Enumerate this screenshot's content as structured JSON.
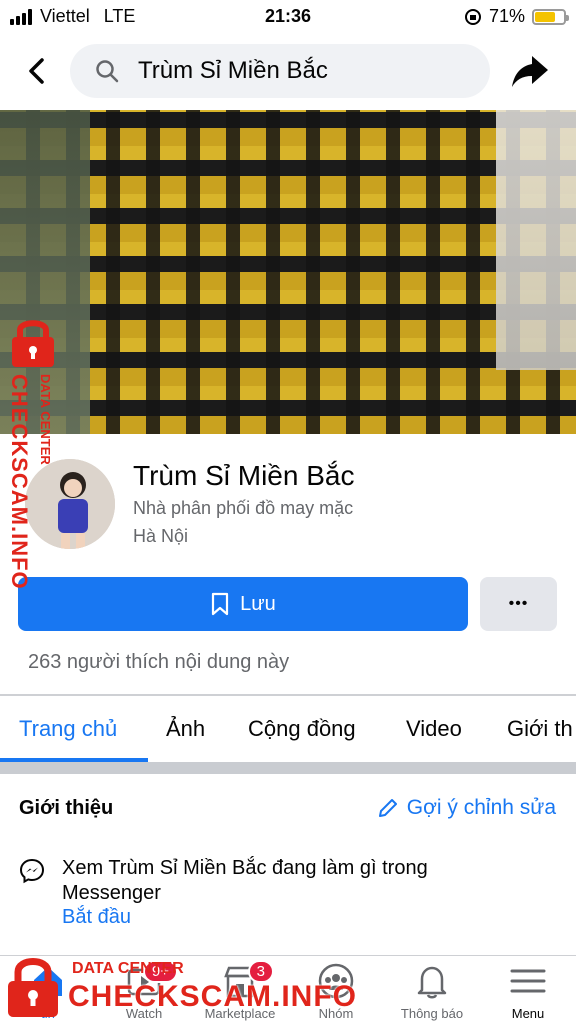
{
  "status_bar": {
    "carrier": "Viettel",
    "network": "LTE",
    "time": "21:36",
    "battery": "71%",
    "battery_level": 0.71
  },
  "search": {
    "query": "Trùm Sỉ Miền Bắc"
  },
  "profile": {
    "name": "Trùm Sỉ Miền Bắc",
    "category": "Nhà phân phối đồ may mặc",
    "location": "Hà Nội",
    "save_label": "Lưu",
    "more_label": "•••",
    "likes_text": "263 người thích nội dung này"
  },
  "tabs": [
    {
      "label": "Trang chủ",
      "active": true
    },
    {
      "label": "Ảnh",
      "active": false
    },
    {
      "label": "Cộng đồng",
      "active": false
    },
    {
      "label": "Video",
      "active": false
    },
    {
      "label": "Giới th",
      "active": false
    }
  ],
  "intro": {
    "title": "Giới thiệu",
    "suggest_edit": "Gợi ý chỉnh sửa",
    "messenger_text": "Xem Trùm Sỉ Miền Bắc đang làm gì trong Messenger",
    "messenger_link": "Bắt đầu"
  },
  "bottom_nav": [
    {
      "label": "tin",
      "icon": "home-icon",
      "active": true
    },
    {
      "label": "Watch",
      "icon": "watch-icon",
      "badge": "9+"
    },
    {
      "label": "Marketplace",
      "icon": "marketplace-icon",
      "badge": "3"
    },
    {
      "label": "Nhóm",
      "icon": "groups-icon"
    },
    {
      "label": "Thông báo",
      "icon": "bell-icon"
    },
    {
      "label": "Menu",
      "icon": "menu-icon"
    }
  ],
  "watermark": {
    "side_text": "CHECKSCAM.INFO",
    "side_small": "DATA CENTER",
    "bottom_small": "DATA CENTER",
    "bottom_big": "CHECKSCAM.INFO"
  },
  "colors": {
    "accent": "#1877f2",
    "watermark": "#e0251b",
    "badge": "#e41e3f"
  }
}
